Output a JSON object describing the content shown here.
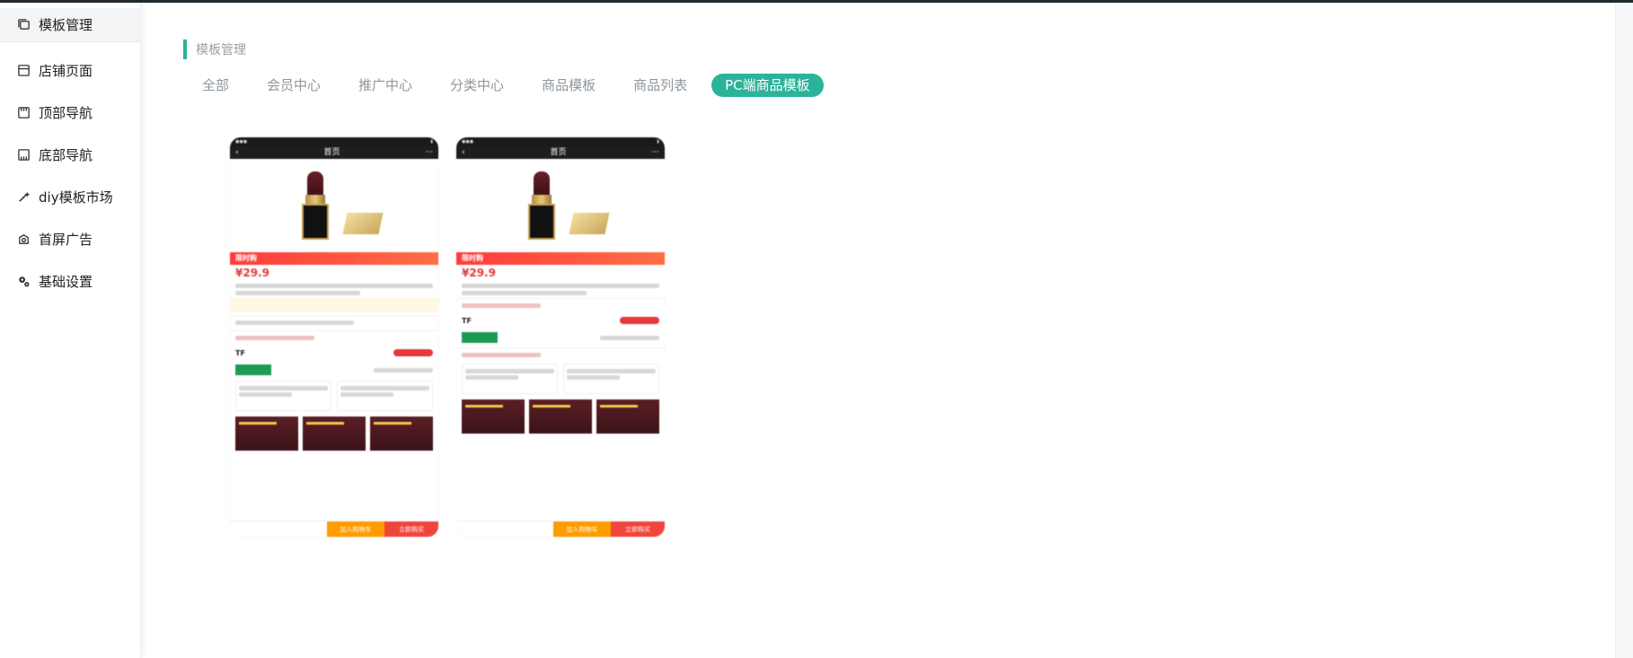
{
  "sidebar": {
    "items": [
      {
        "label": "模板管理",
        "icon": "template-icon",
        "active": true
      },
      {
        "label": "店铺页面",
        "icon": "page-icon",
        "active": false
      },
      {
        "label": "顶部导航",
        "icon": "top-nav-icon",
        "active": false
      },
      {
        "label": "底部导航",
        "icon": "bottom-nav-icon",
        "active": false
      },
      {
        "label": "diy模板市场",
        "icon": "magic-wand-icon",
        "active": false
      },
      {
        "label": "首屏广告",
        "icon": "ad-icon",
        "active": false
      },
      {
        "label": "基础设置",
        "icon": "gear-icon",
        "active": false
      }
    ]
  },
  "main": {
    "section_title": "模板管理",
    "tabs": [
      {
        "label": "全部",
        "active": false
      },
      {
        "label": "会员中心",
        "active": false
      },
      {
        "label": "推广中心",
        "active": false
      },
      {
        "label": "分类中心",
        "active": false
      },
      {
        "label": "商品模板",
        "active": false
      },
      {
        "label": "商品列表",
        "active": false
      },
      {
        "label": "PC端商品模板",
        "active": true
      }
    ],
    "template_cards": [
      {
        "nav_title": "首页",
        "flash_label": "限时购",
        "price": "¥29.9",
        "brand": "TF",
        "add_to_cart": "加入购物车",
        "buy_now": "立即购买"
      },
      {
        "nav_title": "首页",
        "flash_label": "限时购",
        "price": "¥29.9",
        "brand": "TF",
        "add_to_cart": "加入购物车",
        "buy_now": "立即购买"
      }
    ]
  },
  "colors": {
    "accent": "#2bb39a",
    "flash_red": "#ff3b3b",
    "cart_orange": "#ff9c00",
    "buy_red": "#f0453a"
  }
}
